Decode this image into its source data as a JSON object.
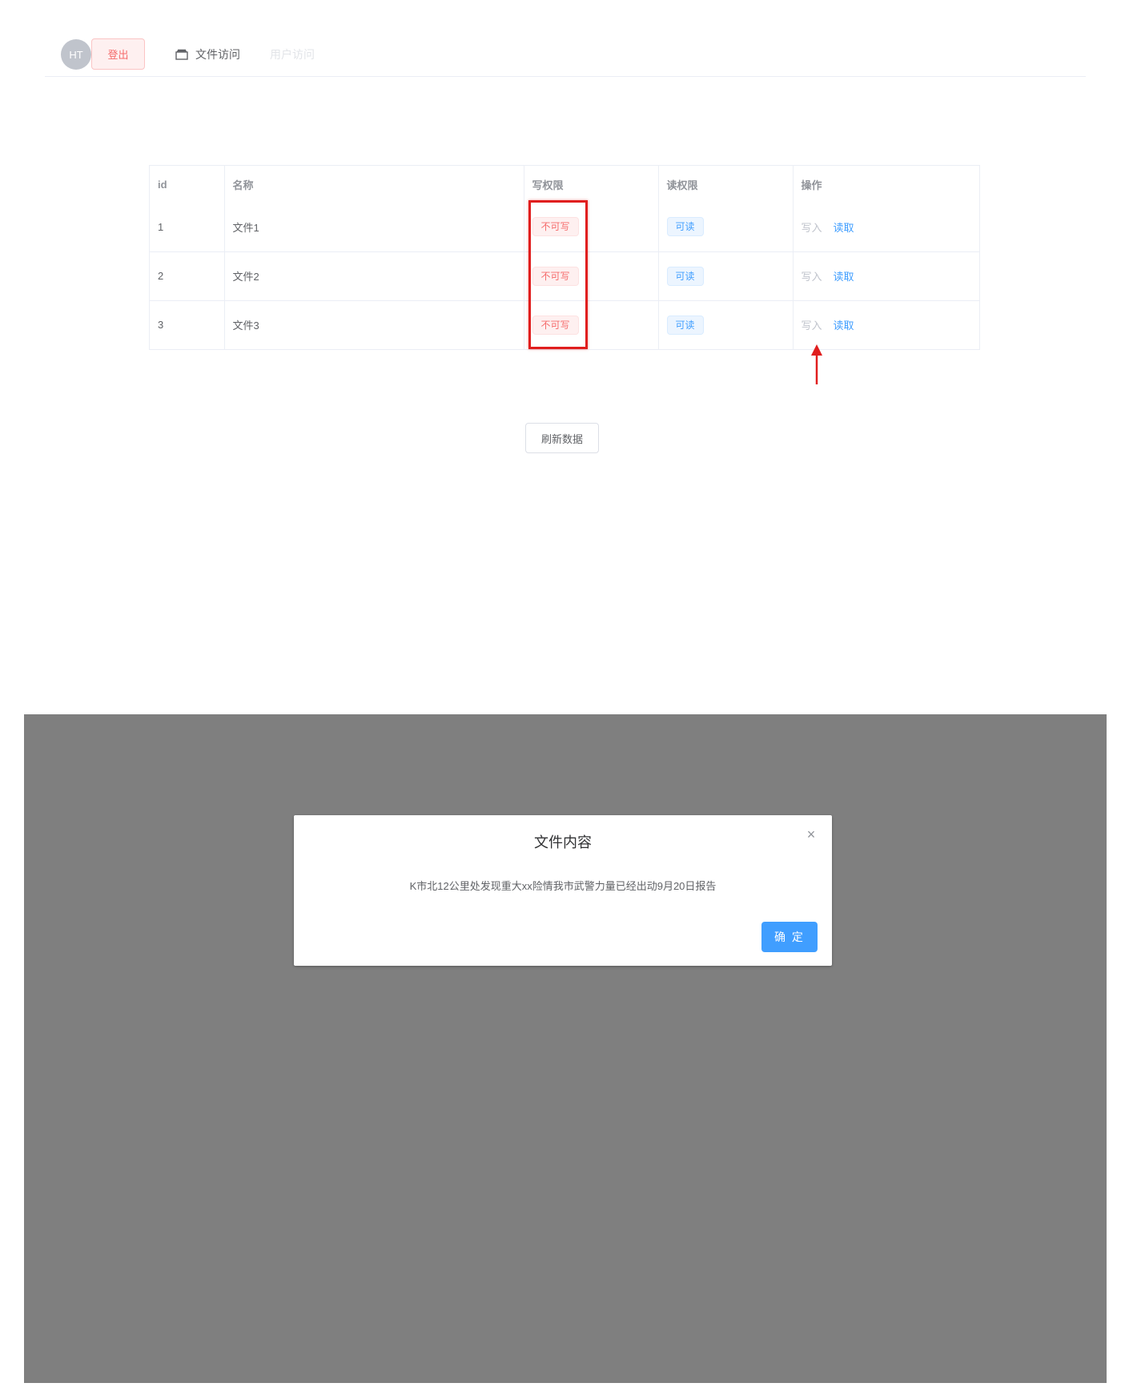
{
  "header": {
    "avatar_text": "HT",
    "logout_label": "登出",
    "nav": {
      "file_access": "文件访问",
      "user_access": "用户访问"
    }
  },
  "table": {
    "columns": [
      "id",
      "名称",
      "写权限",
      "读权限",
      "操作"
    ],
    "rows": [
      {
        "id": "1",
        "name": "文件1",
        "write": "不可写",
        "read": "可读",
        "op_write": "写入",
        "op_read": "读取"
      },
      {
        "id": "2",
        "name": "文件2",
        "write": "不可写",
        "read": "可读",
        "op_write": "写入",
        "op_read": "读取"
      },
      {
        "id": "3",
        "name": "文件3",
        "write": "不可写",
        "read": "可读",
        "op_write": "写入",
        "op_read": "读取"
      }
    ]
  },
  "refresh_label": "刷新数据",
  "dialog": {
    "title": "文件内容",
    "close_icon": "×",
    "content": "K市北12公里处发现重大xx险情我市武警力量已经出动9月20日报告",
    "confirm_label": "确 定"
  },
  "colors": {
    "primary": "#409eff",
    "danger": "#f56c6c",
    "annotation_red": "#e01e1e"
  }
}
